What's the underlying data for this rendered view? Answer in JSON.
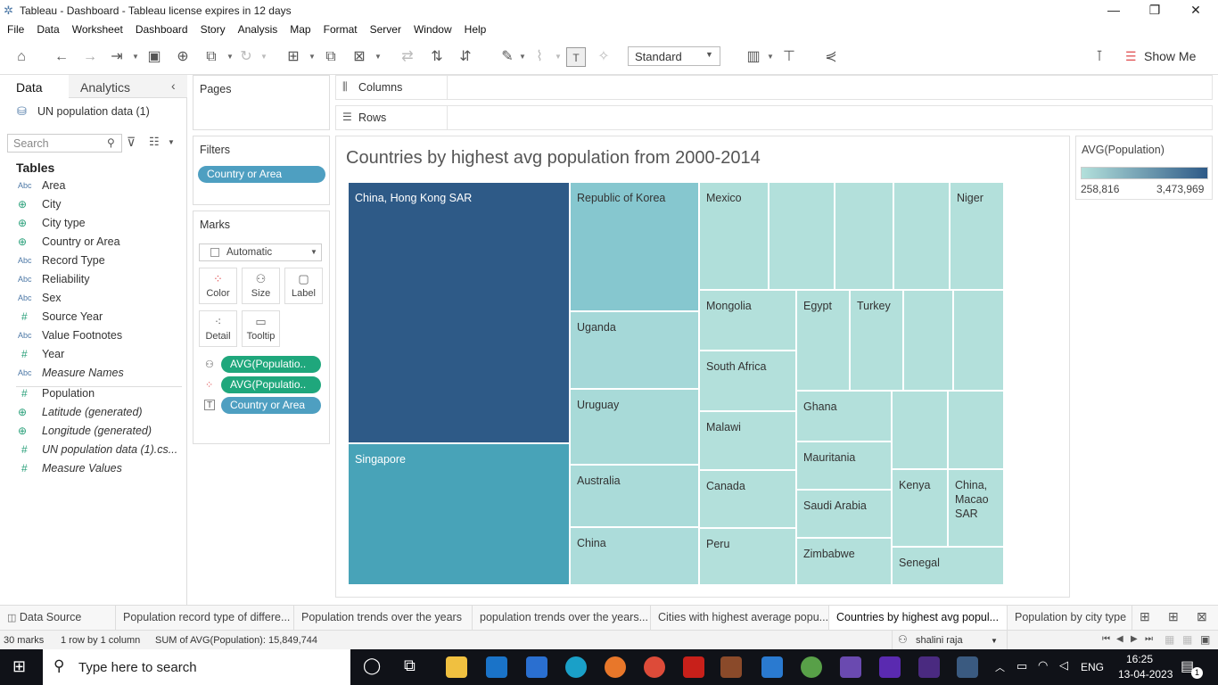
{
  "window": {
    "title": "Tableau - Dashboard - Tableau license expires in 12 days",
    "minimize": "—",
    "restore": "❐",
    "close": "✕"
  },
  "menu": [
    "File",
    "Data",
    "Worksheet",
    "Dashboard",
    "Story",
    "Analysis",
    "Map",
    "Format",
    "Server",
    "Window",
    "Help"
  ],
  "toolbar": {
    "fit_select": "Standard",
    "show_me": "Show Me"
  },
  "left_pane": {
    "tabs": {
      "data": "Data",
      "analytics": "Analytics"
    },
    "datasource": "UN population data (1)",
    "search_placeholder": "Search",
    "tables_heading": "Tables",
    "fields": [
      {
        "type": "Abc",
        "name": "Area",
        "italic": false
      },
      {
        "type": "globe",
        "name": "City",
        "italic": false
      },
      {
        "type": "globe",
        "name": "City type",
        "italic": false
      },
      {
        "type": "globe",
        "name": "Country or Area",
        "italic": false
      },
      {
        "type": "Abc",
        "name": "Record Type",
        "italic": false
      },
      {
        "type": "Abc",
        "name": "Reliability",
        "italic": false
      },
      {
        "type": "Abc",
        "name": "Sex",
        "italic": false
      },
      {
        "type": "#",
        "name": "Source Year",
        "italic": false
      },
      {
        "type": "Abc",
        "name": "Value Footnotes",
        "italic": false
      },
      {
        "type": "#",
        "name": "Year",
        "italic": false
      },
      {
        "type": "Abc",
        "name": "Measure Names",
        "italic": true
      },
      {
        "type": "#",
        "name": "Population",
        "italic": false
      },
      {
        "type": "globe",
        "name": "Latitude (generated)",
        "italic": true
      },
      {
        "type": "globe",
        "name": "Longitude (generated)",
        "italic": true
      },
      {
        "type": "#",
        "name": "UN population data (1).cs...",
        "italic": true
      },
      {
        "type": "#",
        "name": "Measure Values",
        "italic": true
      }
    ]
  },
  "cards": {
    "pages": "Pages",
    "filters": "Filters",
    "filter_pill": "Country or Area",
    "marks": "Marks",
    "mark_type": "Automatic",
    "mark_buttons": {
      "color": "Color",
      "size": "Size",
      "label": "Label",
      "detail": "Detail",
      "tooltip": "Tooltip"
    },
    "mark_pills": [
      "AVG(Populatio..",
      "AVG(Populatio..",
      "Country or Area"
    ]
  },
  "shelves": {
    "columns": "Columns",
    "rows": "Rows"
  },
  "viz": {
    "title": "Countries by highest avg population from 2000-2014",
    "cells": [
      {
        "label": "China, Hong Kong SAR",
        "color": "#2e5a87"
      },
      {
        "label": "Singapore",
        "color": "#48a3b8"
      },
      {
        "label": "Republic of Korea",
        "color": "#86c7cf"
      },
      {
        "label": "Uganda",
        "color": "#a5d8d8"
      },
      {
        "label": "Uruguay",
        "color": "#a8dad8"
      },
      {
        "label": "Australia",
        "color": "#aadbd9"
      },
      {
        "label": "China",
        "color": "#acdcda"
      },
      {
        "label": "Mexico",
        "color": "#b0dfda"
      },
      {
        "label": "",
        "color": "#b2e0db"
      },
      {
        "label": "",
        "color": "#b3e0db"
      },
      {
        "label": "",
        "color": "#b3e0db"
      },
      {
        "label": "Niger",
        "color": "#b3e0db"
      },
      {
        "label": "Mongolia",
        "color": "#b3e0db"
      },
      {
        "label": "Egypt",
        "color": "#b3e0db"
      },
      {
        "label": "Turkey",
        "color": "#b3e0db"
      },
      {
        "label": "",
        "color": "#b3e0db"
      },
      {
        "label": "",
        "color": "#b3e0db"
      },
      {
        "label": "South Africa",
        "color": "#b3e0db"
      },
      {
        "label": "Malawi",
        "color": "#b3e0db"
      },
      {
        "label": "Canada",
        "color": "#b3e0db"
      },
      {
        "label": "Peru",
        "color": "#b3e0db"
      },
      {
        "label": "Ghana",
        "color": "#b3e0db"
      },
      {
        "label": "Mauritania",
        "color": "#b3e0db"
      },
      {
        "label": "Saudi Arabia",
        "color": "#b3e0db"
      },
      {
        "label": "Zimbabwe",
        "color": "#b3e0db"
      },
      {
        "label": "",
        "color": "#b3e0db"
      },
      {
        "label": "",
        "color": "#b3e0db"
      },
      {
        "label": "Kenya",
        "color": "#b3e0db"
      },
      {
        "label": "China, Macao SAR",
        "color": "#b3e0db"
      },
      {
        "label": "Senegal",
        "color": "#b3e0db"
      }
    ]
  },
  "legend": {
    "title": "AVG(Population)",
    "min": "258,816",
    "max": "3,473,969",
    "color_low": "#b3e0db",
    "color_high": "#2e5a87"
  },
  "sheet_tabs": [
    {
      "label": "Data Source",
      "active": false
    },
    {
      "label": "Population record type of differe...",
      "active": false
    },
    {
      "label": "Population trends over the years",
      "active": false
    },
    {
      "label": "population trends over the years...",
      "active": false
    },
    {
      "label": "Cities with highest average popu...",
      "active": false
    },
    {
      "label": "Countries by highest avg popul...",
      "active": true
    },
    {
      "label": "Population by city type",
      "active": false
    }
  ],
  "status": {
    "marks": "30 marks",
    "dims": "1 row by 1 column",
    "sum": "SUM of AVG(Population): 15,849,744",
    "user": "shalini raja"
  },
  "taskbar": {
    "search_placeholder": "Type here to search",
    "lang": "ENG",
    "time": "16:25",
    "date": "13-04-2023",
    "notif_count": "1"
  }
}
